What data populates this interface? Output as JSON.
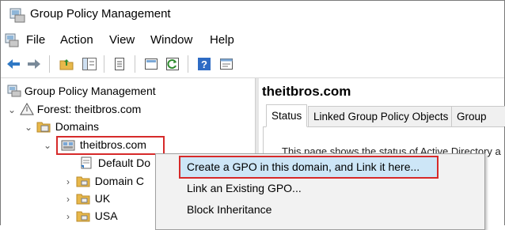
{
  "window": {
    "title": "Group Policy Management"
  },
  "menu": [
    "File",
    "Action",
    "View",
    "Window",
    "Help"
  ],
  "toolbar_icons": [
    "back-arrow-icon",
    "forward-arrow-icon",
    "up-folder-icon",
    "show-tree-icon",
    "properties-icon",
    "export-icon",
    "refresh-icon",
    "help-icon",
    "console-icon"
  ],
  "tree": {
    "root": "Group Policy Management",
    "forest": "Forest: theitbros.com",
    "domains": "Domains",
    "domain": "theitbros.com",
    "children": [
      "Default Do",
      "Domain C",
      "UK",
      "USA"
    ]
  },
  "right_pane": {
    "header": "theitbros.com",
    "tabs": [
      "Status",
      "Linked Group Policy Objects",
      "Group Poli"
    ],
    "status_text": "This page shows the status of Active Directory a"
  },
  "context_menu": {
    "items": [
      "Create a GPO in this domain, and Link it here...",
      "Link an Existing GPO...",
      "Block Inheritance"
    ]
  },
  "colors": {
    "highlight": "#cde6f7",
    "annotation": "#d62a2a",
    "folder": "#e8b84a"
  }
}
